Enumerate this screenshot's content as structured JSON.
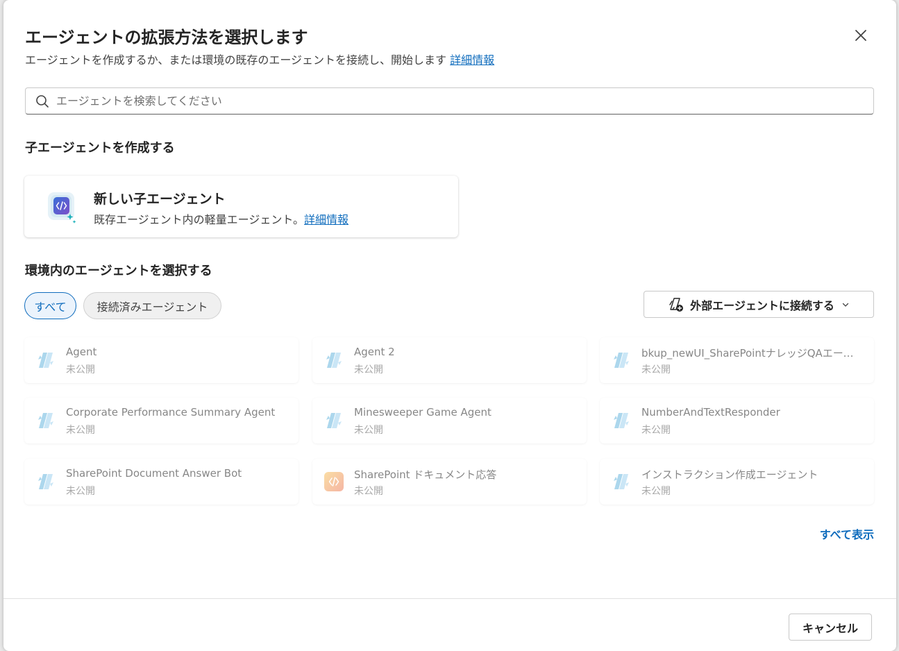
{
  "dialog": {
    "title": "エージェントの拡張方法を選択します",
    "subtitle": "エージェントを作成するか、または環境の既存のエージェントを接続し、開始します",
    "subtitle_link": "詳細情報"
  },
  "search": {
    "placeholder": "エージェントを検索してください"
  },
  "create_section": {
    "heading": "子エージェントを作成する",
    "card": {
      "title": "新しい子エージェント",
      "description": "既存エージェント内の軽量エージェント。",
      "link": "詳細情報"
    }
  },
  "select_section": {
    "heading": "環境内のエージェントを選択する",
    "filters": [
      {
        "label": "すべて",
        "selected": true
      },
      {
        "label": "接続済みエージェント",
        "selected": false
      }
    ],
    "connect_button": "外部エージェントに接続する",
    "agents": [
      {
        "name": "Agent",
        "status": "未公開",
        "icon": "copilot-studio-icon"
      },
      {
        "name": "Agent 2",
        "status": "未公開",
        "icon": "copilot-studio-icon"
      },
      {
        "name": "bkup_newUI_SharePointナレッジQAエージェント",
        "status": "未公開",
        "icon": "copilot-studio-icon"
      },
      {
        "name": "Corporate Performance Summary Agent",
        "status": "未公開",
        "icon": "copilot-studio-icon"
      },
      {
        "name": "Minesweeper Game Agent",
        "status": "未公開",
        "icon": "copilot-studio-icon"
      },
      {
        "name": "NumberAndTextResponder",
        "status": "未公開",
        "icon": "copilot-studio-icon"
      },
      {
        "name": "SharePoint Document Answer Bot",
        "status": "未公開",
        "icon": "copilot-studio-icon"
      },
      {
        "name": "SharePoint ドキュメント応答",
        "status": "未公開",
        "icon": "code-agent-orange-icon"
      },
      {
        "name": "インストラクション作成エージェント",
        "status": "未公開",
        "icon": "copilot-studio-icon"
      }
    ],
    "show_all": "すべて表示"
  },
  "footer": {
    "cancel": "キャンセル"
  },
  "colors": {
    "accent": "#0f6cbd",
    "agent_icon_blue": "#6ab7e0",
    "agent_icon_orange": "#f0a050"
  }
}
